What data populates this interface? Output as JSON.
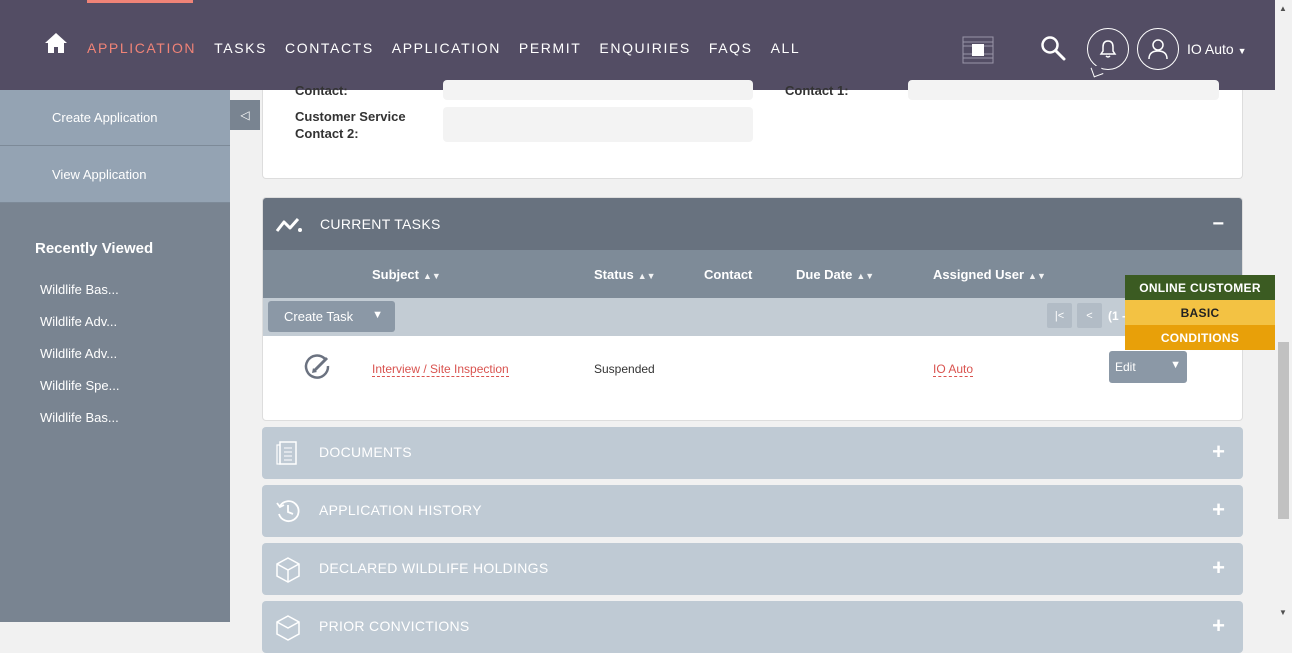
{
  "nav": {
    "items": [
      "APPLICATION",
      "TASKS",
      "CONTACTS",
      "APPLICATION",
      "PERMIT",
      "ENQUIRIES",
      "FAQS",
      "ALL"
    ],
    "active_index": 0,
    "user_name": "IO Auto"
  },
  "sidebar": {
    "actions": [
      "Create Application",
      "View Application"
    ],
    "recent_title": "Recently Viewed",
    "recent_items": [
      "Wildlife Bas...",
      "Wildlife Adv...",
      "Wildlife Adv...",
      "Wildlife Spe...",
      "Wildlife Bas..."
    ]
  },
  "details": {
    "contact_label_partial": "Contact:",
    "contact1_label_partial": "Contact 1:",
    "cs_contact2_label": "Customer Service Contact 2:"
  },
  "current_tasks": {
    "title": "CURRENT TASKS",
    "toggle": "−",
    "columns": [
      "Subject",
      "Status",
      "Contact",
      "Due Date",
      "Assigned User"
    ],
    "create_task_label": "Create Task",
    "pager_first": "|<",
    "pager_prev": "<",
    "pager_text": "(1 -",
    "rows": [
      {
        "subject": "Interview / Site Inspection",
        "status": "Suspended",
        "contact": "",
        "due_date": "",
        "assigned_user": "IO Auto",
        "action": "Edit"
      }
    ]
  },
  "panels": [
    {
      "title": "DOCUMENTS",
      "icon": "document-icon",
      "toggle": "+"
    },
    {
      "title": "APPLICATION HISTORY",
      "icon": "history-icon",
      "toggle": "+"
    },
    {
      "title": "DECLARED WILDLIFE HOLDINGS",
      "icon": "cube-icon",
      "toggle": "+"
    },
    {
      "title": "PRIOR CONVICTIONS",
      "icon": "cube-icon",
      "toggle": "+"
    }
  ],
  "tags": [
    {
      "label": "ONLINE CUSTOMER",
      "bg": "#3b5b22",
      "fg": "#ffffff"
    },
    {
      "label": "BASIC",
      "bg": "#f3c243",
      "fg": "#222222"
    },
    {
      "label": "CONDITIONS",
      "bg": "#e8a009",
      "fg": "#ffffff"
    }
  ],
  "colors": {
    "topbar": "#534d64",
    "accent": "#f08377",
    "sidebar": "#798491",
    "panel_header": "#68727f",
    "link": "#d9534f"
  }
}
